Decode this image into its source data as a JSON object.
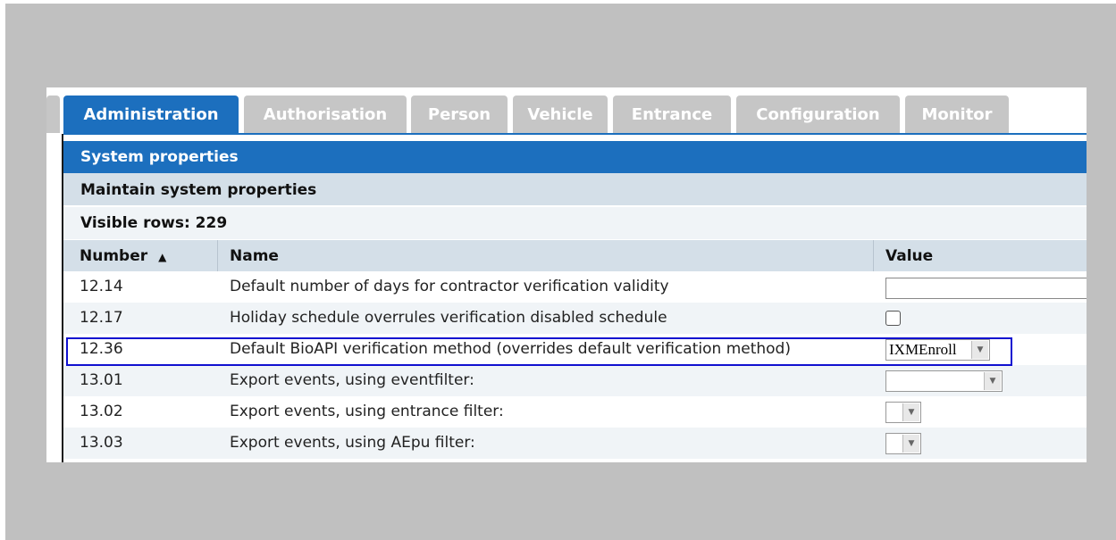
{
  "tabs": [
    {
      "label": "Administration",
      "active": true
    },
    {
      "label": "Authorisation",
      "active": false
    },
    {
      "label": "Person",
      "active": false
    },
    {
      "label": "Vehicle",
      "active": false
    },
    {
      "label": "Entrance",
      "active": false
    },
    {
      "label": "Configuration",
      "active": false
    },
    {
      "label": "Monitor",
      "active": false
    }
  ],
  "section_title": "System properties",
  "subsection_title": "Maintain system properties",
  "visible_rows": "Visible rows: 229",
  "columns": {
    "number": "Number",
    "sort_indicator": "▲",
    "name": "Name",
    "value": "Value"
  },
  "rows": [
    {
      "number": "12.14",
      "name": "Default number of days for contractor verification validity",
      "value_type": "text",
      "value": ""
    },
    {
      "number": "12.17",
      "name": "Holiday schedule overrules verification disabled schedule",
      "value_type": "checkbox",
      "value": "unchecked"
    },
    {
      "number": "12.36",
      "name": "Default BioAPI verification method (overrides default verification method)",
      "value_type": "select",
      "value": "IXMEnroll",
      "highlighted": true
    },
    {
      "number": "13.01",
      "name": "Export events, using eventfilter:",
      "value_type": "select",
      "value": ""
    },
    {
      "number": "13.02",
      "name": "Export events, using entrance filter:",
      "value_type": "select",
      "value": ""
    },
    {
      "number": "13.03",
      "name": "Export events, using AEpu filter:",
      "value_type": "select",
      "value": ""
    }
  ],
  "colors": {
    "tab_active": "#1c6fbe",
    "tab_inactive": "#c6c6c6",
    "header_bar": "#1c6fbe",
    "sub_bar": "#d4dfe8",
    "highlight_border": "#1010d0",
    "background": "#c0c0c0"
  },
  "icons": {
    "sort": "sort-ascending-icon",
    "dropdown": "chevron-down-icon"
  }
}
